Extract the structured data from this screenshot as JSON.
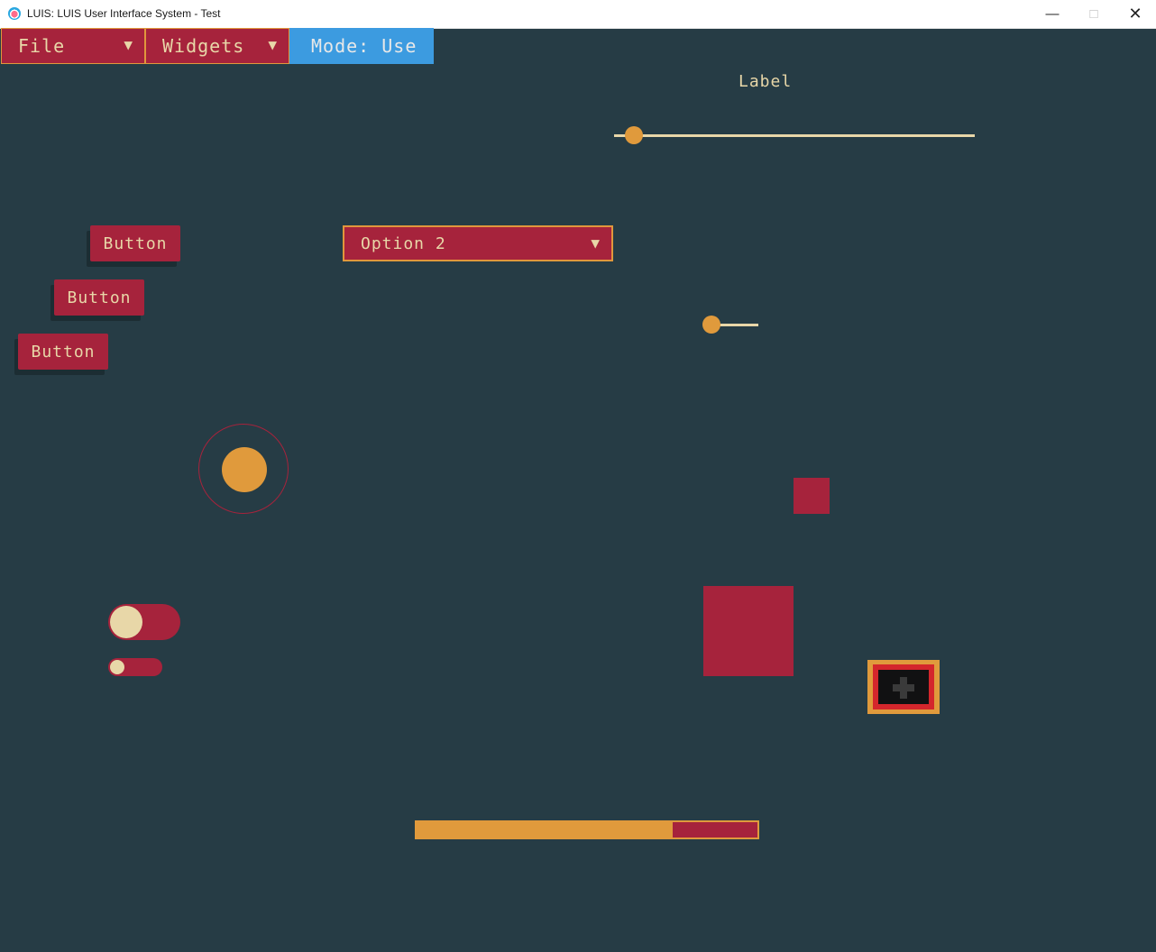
{
  "window": {
    "title": "LUIS: LUIS User Interface System - Test"
  },
  "menubar": {
    "file_label": "File",
    "widgets_label": "Widgets",
    "mode_label": "Mode: Use",
    "dropdown_arrow": "▼"
  },
  "label_text": "Label",
  "buttons": [
    "Button",
    "Button",
    "Button"
  ],
  "dropdown": {
    "selected": "Option 2"
  },
  "sliders": {
    "horizontal_large_value": 0.05,
    "horizontal_small_value": 0.0
  },
  "progress": {
    "value": 0.75
  },
  "toggles": {
    "large_on": false,
    "small_on": false
  },
  "colors": {
    "background": "#263c45",
    "primary": "#a6233c",
    "accent": "#e09a3c",
    "text": "#e8d7a8",
    "mode": "#3c9be0"
  },
  "icons": {
    "window_min": "minimize-icon",
    "window_max": "maximize-icon",
    "window_close": "close-icon",
    "image_placeholder": "plus-icon"
  }
}
